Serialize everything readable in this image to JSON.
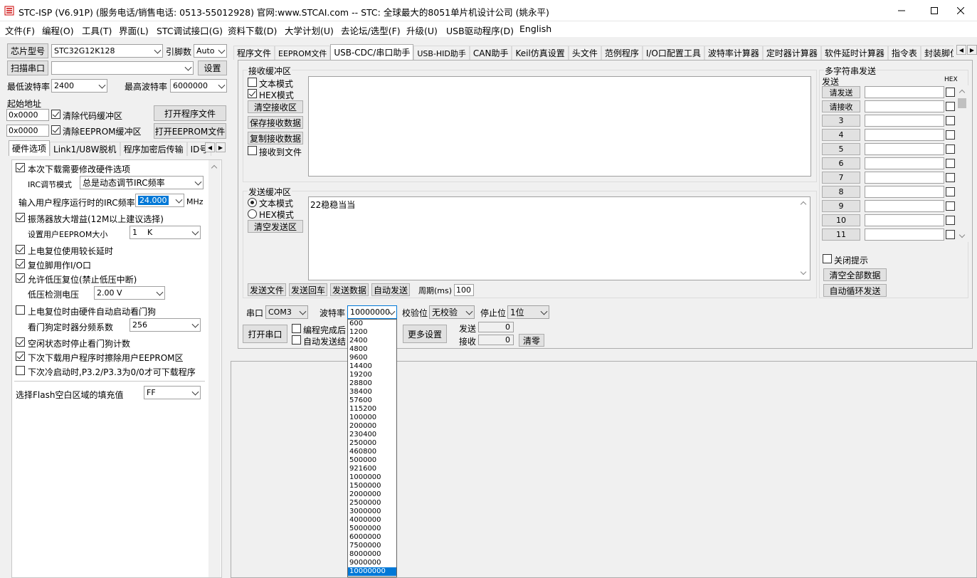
{
  "window": {
    "title": "STC-ISP (V6.91P) (服务电话/销售电话: 0513-55012928) 官网:www.STCAI.com  -- STC: 全球最大的8051单片机设计公司 (姚永平)",
    "minimize_glyph": "—",
    "maximize_glyph": "☐",
    "close_glyph": "✕"
  },
  "menu": [
    "文件(F)",
    "编程(O)",
    "工具(T)",
    "界面(L)",
    "STC调试接口(G)",
    "资料下载(D)",
    "大学计划(U)",
    "去论坛/选型(F)",
    "升级(U)",
    "USB驱动程序(D)",
    "English"
  ],
  "left": {
    "chip_type_btn": "芯片型号",
    "chip_type_value": "STC32G12K128",
    "pin_count_label": "引脚数",
    "pin_count_value": "Auto",
    "scan_port_btn": "扫描串口",
    "port_value": "",
    "settings_btn": "设置",
    "min_baud_label": "最低波特率",
    "min_baud_value": "2400",
    "max_baud_label": "最高波特率",
    "max_baud_value": "6000000",
    "start_addr_label": "起始地址",
    "addr1": "0x0000",
    "clear_code_label": "清除代码缓冲区",
    "open_prog_btn": "打开程序文件",
    "addr2": "0x0000",
    "clear_eeprom_label": "清除EEPROM缓冲区",
    "open_eeprom_btn": "打开EEPROM文件",
    "tabs": [
      "硬件选项",
      "Link1/U8W脱机",
      "程序加密后传输",
      "ID号"
    ],
    "hw": {
      "modify_hw": "本次下载需要修改硬件选项",
      "irc_mode_label": "IRC调节模式",
      "irc_mode_value": "总是动态调节IRC频率",
      "irc_freq_label": "输入用户程序运行时的IRC频率",
      "irc_freq_value": "24.000",
      "irc_freq_unit": "MHz",
      "osc_gain": "振荡器放大增益(12M以上建议选择)",
      "eeprom_size_label": "设置用户EEPROM大小",
      "eeprom_size_value": "1    K",
      "por_delay": "上电复位使用较长延时",
      "reset_io": "复位脚用作I/O口",
      "lvr": "允许低压复位(禁止低压中断)",
      "lvd_label": "低压检测电压",
      "lvd_value": "2.00 V",
      "wdt_por": "上电复位时由硬件自动启动看门狗",
      "wdt_div_label": "看门狗定时器分频系数",
      "wdt_div_value": "256",
      "wdt_idle": "空闲状态时停止看门狗计数",
      "erase_eeprom": "下次下载用户程序时擦除用户EEPROM区",
      "cold_boot": "下次冷启动时,P3.2/P3.3为0/0才可下载程序",
      "flash_fill_label": "选择Flash空白区域的填充值",
      "flash_fill_value": "FF"
    }
  },
  "right": {
    "tabs": [
      "程序文件",
      "EEPROM文件",
      "USB-CDC/串口助手",
      "USB-HID助手",
      "CAN助手",
      "Keil仿真设置",
      "头文件",
      "范例程序",
      "I/O口配置工具",
      "波特率计算器",
      "定时器计算器",
      "软件延时计算器",
      "指令表",
      "封装脚位"
    ],
    "recv": {
      "title": "接收缓冲区",
      "text_mode": "文本模式",
      "hex_mode": "HEX模式",
      "clear": "清空接收区",
      "save": "保存接收数据",
      "copy": "复制接收数据",
      "to_file": "接收到文件"
    },
    "send": {
      "title": "发送缓冲区",
      "text_mode": "文本模式",
      "hex_mode": "HEX模式",
      "clear": "清空发送区",
      "content": "22稳稳当当",
      "send_file": "发送文件",
      "send_return": "发送回车",
      "send_data": "发送数据",
      "auto_send": "自动发送",
      "period_label": "周期(ms)",
      "period_value": "100"
    },
    "port_label": "串口",
    "port_value": "COM3",
    "baud_label": "波特率",
    "baud_value": "10000000",
    "parity_label": "校验位",
    "parity_value": "无校验",
    "stop_label": "停止位",
    "stop_value": "1位",
    "open_port": "打开串口",
    "prog_done_label": "编程完成后",
    "auto_send_end_label": "自动发送结",
    "more_settings": "更多设置",
    "tx_label": "发送",
    "tx_value": "0",
    "rx_label": "接收",
    "rx_value": "0",
    "clear_counts": "清零",
    "baud_options": [
      "600",
      "1200",
      "2400",
      "4800",
      "9600",
      "14400",
      "19200",
      "28800",
      "38400",
      "57600",
      "115200",
      "100000",
      "200000",
      "230400",
      "250000",
      "460800",
      "500000",
      "921600",
      "1000000",
      "1500000",
      "2000000",
      "2500000",
      "3000000",
      "4000000",
      "5000000",
      "6000000",
      "7500000",
      "8000000",
      "9000000",
      "10000000"
    ],
    "baud_selected_index": 29
  },
  "multi": {
    "title": "多字符串发送",
    "send_header": "发送",
    "hex_header": "HEX",
    "rows": [
      "请发送",
      "请接收",
      "3",
      "4",
      "5",
      "6",
      "7",
      "8",
      "9",
      "10",
      "11"
    ],
    "close_hint": "关闭提示",
    "clear_all": "清空全部数据",
    "auto_loop": "自动循环发送"
  }
}
